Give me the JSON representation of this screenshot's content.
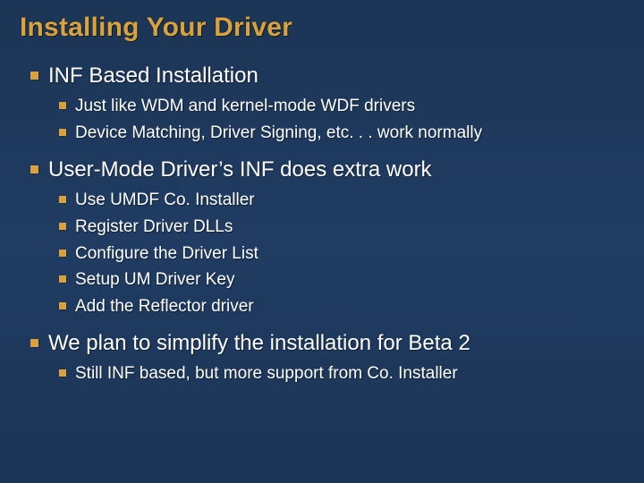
{
  "title": "Installing Your Driver",
  "bullets": {
    "b0": {
      "text": "INF Based Installation",
      "sub": {
        "s0": "Just like WDM and kernel-mode WDF drivers",
        "s1": "Device Matching, Driver Signing, etc. . . work normally"
      }
    },
    "b1": {
      "text": "User-Mode Driver’s INF does extra work",
      "sub": {
        "s0": "Use UMDF Co. Installer",
        "s1": "Register Driver DLLs",
        "s2": "Configure the Driver List",
        "s3": "Setup UM Driver Key",
        "s4": "Add the Reflector driver"
      }
    },
    "b2": {
      "text": "We plan to simplify the installation for Beta 2",
      "sub": {
        "s0": "Still INF based, but more support from Co. Installer"
      }
    }
  }
}
